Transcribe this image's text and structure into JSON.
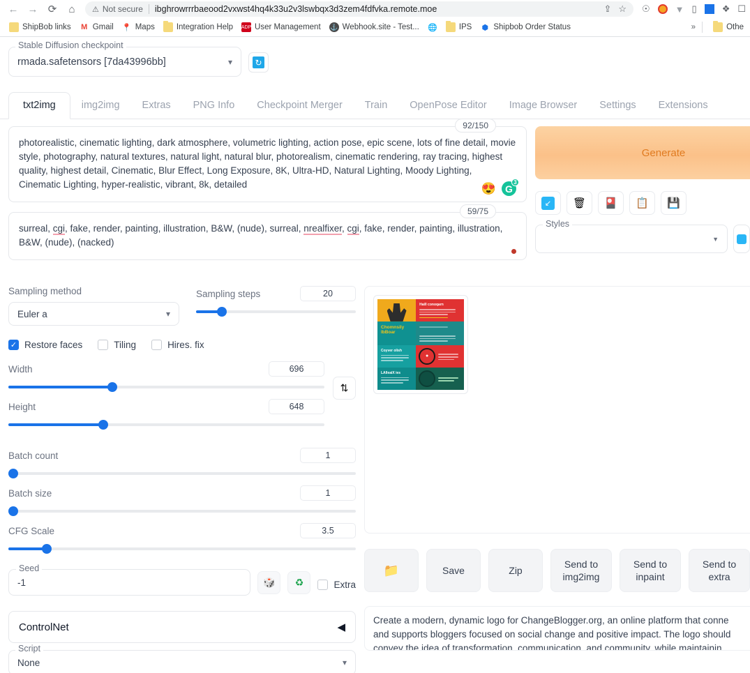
{
  "browser": {
    "back_icon": "←",
    "forward_icon": "→",
    "reload_icon": "⟳",
    "home_icon": "⌂",
    "security_label": "Not secure",
    "url": "ibghrowrrrbaeood2vxwst4hq4k33u2v3lswbqx3d3zem4fdfvka.remote.moe",
    "share_icon": "⇪",
    "star_icon": "☆",
    "bookmarks": [
      {
        "label": "ShipBob links",
        "icon": "list-icon"
      },
      {
        "label": "Gmail",
        "icon": "gmail-icon"
      },
      {
        "label": "Maps",
        "icon": "maps-pin-icon"
      },
      {
        "label": "Integration Help",
        "icon": "folder-icon"
      },
      {
        "label": "User Management",
        "icon": "adp-icon"
      },
      {
        "label": "Webhook.site - Test...",
        "icon": "anchor-icon"
      },
      {
        "label": "IPS",
        "icon": "folder-icon"
      },
      {
        "label": "Shipbob Order Status",
        "icon": "shield-icon"
      }
    ],
    "overflow_label": "»",
    "other_bookmarks_label": "Othe"
  },
  "checkpoint": {
    "legend": "Stable Diffusion checkpoint",
    "value": "rmada.safetensors [7da43996bb]",
    "refresh_icon": "⟳"
  },
  "tabs": [
    {
      "label": "txt2img",
      "active": true
    },
    {
      "label": "img2img",
      "active": false
    },
    {
      "label": "Extras",
      "active": false
    },
    {
      "label": "PNG Info",
      "active": false
    },
    {
      "label": "Checkpoint Merger",
      "active": false
    },
    {
      "label": "Train",
      "active": false
    },
    {
      "label": "OpenPose Editor",
      "active": false
    },
    {
      "label": "Image Browser",
      "active": false
    },
    {
      "label": "Settings",
      "active": false
    },
    {
      "label": "Extensions",
      "active": false
    }
  ],
  "prompt": {
    "token_count": "92/150",
    "text": "photorealistic, cinematic lighting, dark atmosphere, volumetric lighting, action pose, epic scene, lots of fine detail, movie style, photography, natural textures, natural light, natural blur, photorealism, cinematic rendering, ray tracing, highest quality, highest detail, Cinematic, Blur Effect, Long Exposure, 8K, Ultra-HD, Natural Lighting, Moody Lighting, Cinematic Lighting, hyper-realistic, vibrant, 8k, detailed",
    "emoji_icon": "😍",
    "grammarly_icon": "G",
    "grammarly_badge": "3"
  },
  "negative_prompt": {
    "token_count": "59/75",
    "part1": "surreal, ",
    "mark1": "cgi",
    "part2": ", fake, render, painting, illustration, B&W, (nude), surreal, ",
    "mark2": "nrealfixer",
    "part3": ", ",
    "mark3": "cgi",
    "part4": ", fake, render, painting, illustration, B&W, (nude), (nacked)"
  },
  "generate": {
    "label": "Generate",
    "tools": [
      {
        "name": "paste-arrow-icon",
        "glyph": "↙"
      },
      {
        "name": "trash-icon",
        "glyph": "🗑"
      },
      {
        "name": "extra-networks-icon",
        "glyph": "🎴"
      },
      {
        "name": "clipboard-icon",
        "glyph": "📋"
      },
      {
        "name": "save-style-icon",
        "glyph": "💾"
      }
    ],
    "styles_legend": "Styles",
    "styles_value": ""
  },
  "settings": {
    "sampling_method": {
      "label": "Sampling method",
      "value": "Euler a"
    },
    "sampling_steps": {
      "label": "Sampling steps",
      "value": "20",
      "fill_pct": 16
    },
    "checkboxes": [
      {
        "label": "Restore faces",
        "checked": true
      },
      {
        "label": "Tiling",
        "checked": false
      },
      {
        "label": "Hires. fix",
        "checked": false
      }
    ],
    "width": {
      "label": "Width",
      "value": "696",
      "fill_pct": 33
    },
    "height": {
      "label": "Height",
      "value": "648",
      "fill_pct": 30
    },
    "swap_icon": "⇅",
    "batch_count": {
      "label": "Batch count",
      "value": "1",
      "fill_pct": 0
    },
    "batch_size": {
      "label": "Batch size",
      "value": "1",
      "fill_pct": 0
    },
    "cfg_scale": {
      "label": "CFG Scale",
      "value": "3.5",
      "fill_pct": 11
    },
    "seed": {
      "legend": "Seed",
      "value": "-1",
      "dice_icon": "🎲",
      "recycle_icon": "♻",
      "extra_label": "Extra",
      "extra_checked": false
    },
    "controlnet": {
      "label": "ControlNet",
      "caret": "◀"
    },
    "script": {
      "legend": "Script",
      "value": "None"
    }
  },
  "results": {
    "actions": [
      {
        "label": "📁",
        "name": "open-folder-button"
      },
      {
        "label": "Save",
        "name": "save-button"
      },
      {
        "label": "Zip",
        "name": "zip-button"
      },
      {
        "label": "Send to img2img",
        "name": "send-to-img2img-button"
      },
      {
        "label": "Send to inpaint",
        "name": "send-to-inpaint-button"
      },
      {
        "label": "Send to extra",
        "name": "send-to-extras-button"
      }
    ],
    "description_lines": [
      "Create a modern, dynamic logo for ChangeBlogger.org, an online platform that conne",
      "and supports bloggers focused on social change and positive impact. The logo should",
      "convey the idea of transformation, communication, and community, while maintainin"
    ],
    "thumbnail": {
      "title_b": "Haill conoqarn",
      "title_c": "Chomnsily lbBoar",
      "title_e": "Coyver olish",
      "title_g": "LAlleaiX ies"
    }
  }
}
